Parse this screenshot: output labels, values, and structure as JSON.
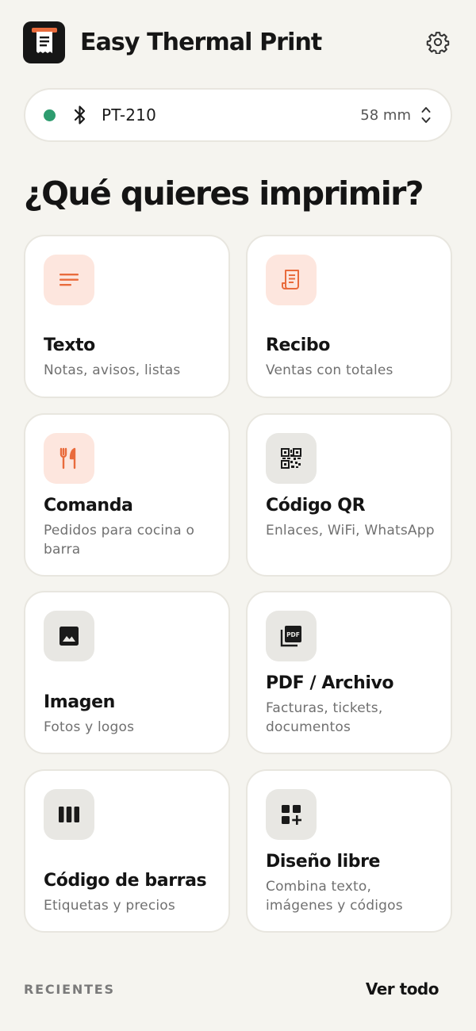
{
  "app": {
    "title": "Easy Thermal Print",
    "accent": "#e96b3c",
    "background": "#f5f4ef"
  },
  "header": {
    "logo_icon": "receipt-icon",
    "settings_icon": "gear-icon"
  },
  "printer": {
    "status": "connected",
    "status_color": "#2e9c6f",
    "connection_icon": "bluetooth-icon",
    "name": "PT-210",
    "paper_size": "58 mm",
    "paper_selector_icon": "chevron-up-down-icon"
  },
  "section": {
    "title": "¿Qué quieres imprimir?"
  },
  "options": [
    {
      "title": "Texto",
      "subtitle": "Notas, avisos, listas",
      "icon": "text-lines-icon",
      "icon_style": "orange"
    },
    {
      "title": "Recibo",
      "subtitle": "Ventas con totales",
      "icon": "receipt-icon",
      "icon_style": "orange"
    },
    {
      "title": "Comanda",
      "subtitle": "Pedidos para cocina o barra",
      "icon": "restaurant-icon",
      "icon_style": "orange"
    },
    {
      "title": "Código QR",
      "subtitle": "Enlaces, WiFi, WhatsApp",
      "icon": "qr-code-icon",
      "icon_style": "gray"
    },
    {
      "title": "Imagen",
      "subtitle": "Fotos y logos",
      "icon": "image-icon",
      "icon_style": "gray"
    },
    {
      "title": "PDF / Archivo",
      "subtitle": "Facturas, tickets, documentos",
      "icon": "pdf-icon",
      "icon_style": "gray"
    },
    {
      "title": "Código de barras",
      "subtitle": "Etiquetas y precios",
      "icon": "barcode-icon",
      "icon_style": "gray"
    },
    {
      "title": "Diseño libre",
      "subtitle": "Combina texto, imágenes y códigos",
      "icon": "add-layout-icon",
      "icon_style": "gray"
    }
  ],
  "recents": {
    "label": "RECIENTES",
    "see_all": "Ver todo"
  }
}
